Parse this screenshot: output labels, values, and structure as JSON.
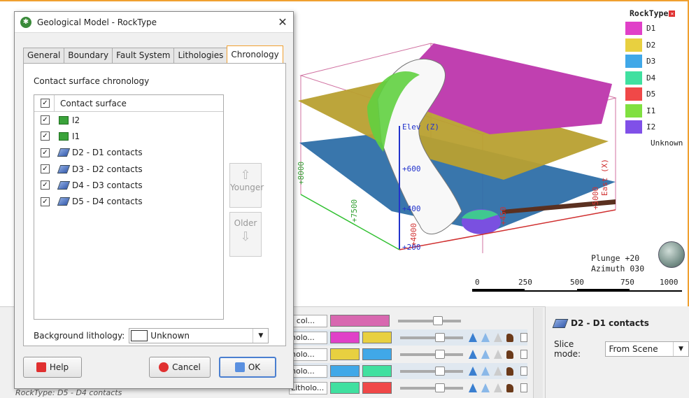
{
  "dialog": {
    "title": "Geological Model - RockType",
    "close": "✕",
    "tabs": [
      {
        "label": "General"
      },
      {
        "label": "Boundary"
      },
      {
        "label": "Fault System"
      },
      {
        "label": "Lithologies"
      },
      {
        "label": "Chronology"
      }
    ],
    "active_tab": "Chronology",
    "section_label": "Contact surface chronology",
    "list_header": "Contact surface",
    "items": [
      {
        "label": "I2",
        "checked": true,
        "icon": "intrusion-icon"
      },
      {
        "label": "I1",
        "checked": true,
        "icon": "intrusion-icon"
      },
      {
        "label": "D2 - D1 contacts",
        "checked": true,
        "icon": "contact-surface-icon"
      },
      {
        "label": "D3 - D2 contacts",
        "checked": true,
        "icon": "contact-surface-icon"
      },
      {
        "label": "D4 - D3 contacts",
        "checked": true,
        "icon": "contact-surface-icon"
      },
      {
        "label": "D5 - D4 contacts",
        "checked": true,
        "icon": "contact-surface-icon"
      }
    ],
    "younger_label": "Younger",
    "older_label": "Older",
    "background_label": "Background lithology:",
    "background_value": "Unknown",
    "help_label": "Help",
    "cancel_label": "Cancel",
    "ok_label": "OK"
  },
  "legend": {
    "title": "RockType",
    "items": [
      {
        "label": "D1",
        "color": "#e040c8"
      },
      {
        "label": "D2",
        "color": "#e8d040"
      },
      {
        "label": "D3",
        "color": "#40a8e8"
      },
      {
        "label": "D4",
        "color": "#40e0a0"
      },
      {
        "label": "D5",
        "color": "#f04848"
      },
      {
        "label": "I1",
        "color": "#80e040"
      },
      {
        "label": "I2",
        "color": "#8050e8"
      }
    ],
    "unknown": "Unknown"
  },
  "scene": {
    "elev_label": "Elev (Z)",
    "east_label": "East (X)",
    "ticks": [
      "+600",
      "+400",
      "+200",
      "+8000",
      "+7500",
      "+4000",
      "+5000",
      "+450"
    ],
    "plunge": "Plunge +20",
    "azimuth": "Azimuth 030",
    "scale": [
      "0",
      "250",
      "500",
      "750",
      "1000"
    ]
  },
  "bottom": {
    "rows": [
      {
        "select": "t col...",
        "colors": [
          "#d868b0"
        ]
      },
      {
        "select": "holo...",
        "colors": [
          "#e040c8",
          "#e8d040"
        ]
      },
      {
        "select": "holo...",
        "colors": [
          "#e8d040",
          "#40a8e8"
        ]
      },
      {
        "select": "holo...",
        "colors": [
          "#40a8e8",
          "#40e0a0"
        ]
      },
      {
        "select": "Litholo...",
        "colors": [
          "#40e0a0",
          "#f04848"
        ]
      }
    ],
    "tree_item": "RockType: D5 - D4 contacts"
  },
  "properties": {
    "title": "D2 - D1 contacts",
    "slice_mode_label": "Slice mode:",
    "slice_mode_value": "From Scene"
  }
}
